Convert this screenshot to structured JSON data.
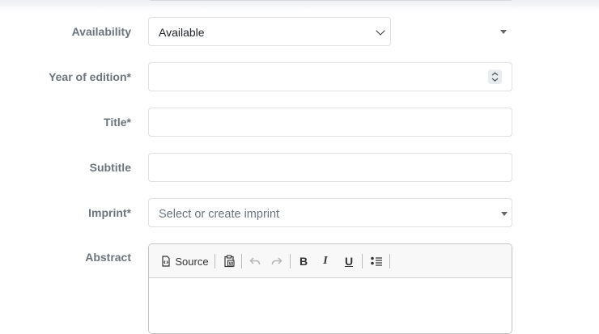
{
  "form": {
    "availability": {
      "label": "Availability",
      "value": "Available"
    },
    "year_of_edition": {
      "label": "Year of edition*",
      "value": ""
    },
    "title": {
      "label": "Title*",
      "value": ""
    },
    "subtitle": {
      "label": "Subtitle",
      "value": ""
    },
    "imprint": {
      "label": "Imprint*",
      "placeholder": "Select or create imprint"
    },
    "abstract": {
      "label": "Abstract",
      "toolbar": {
        "source_label": "Source",
        "bold_label": "B",
        "italic_label": "I",
        "underline_label": "U"
      }
    }
  }
}
